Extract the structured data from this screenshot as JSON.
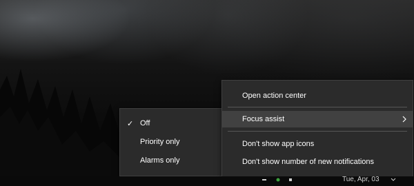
{
  "focus_submenu": {
    "items": [
      {
        "label": "Off",
        "checked": true
      },
      {
        "label": "Priority only",
        "checked": false
      },
      {
        "label": "Alarms only",
        "checked": false
      }
    ],
    "check_glyph": "✓"
  },
  "context_menu": {
    "open_action_center": "Open action center",
    "focus_assist": "Focus assist",
    "dont_show_app_icons": "Don't show app icons",
    "dont_show_count": "Don't show number of new notifications"
  },
  "taskbar": {
    "date": "Tue, Apr, 03"
  },
  "colors": {
    "menu_bg": "#2b2b2b",
    "hover_bg": "#414141",
    "text": "#ffffff"
  }
}
